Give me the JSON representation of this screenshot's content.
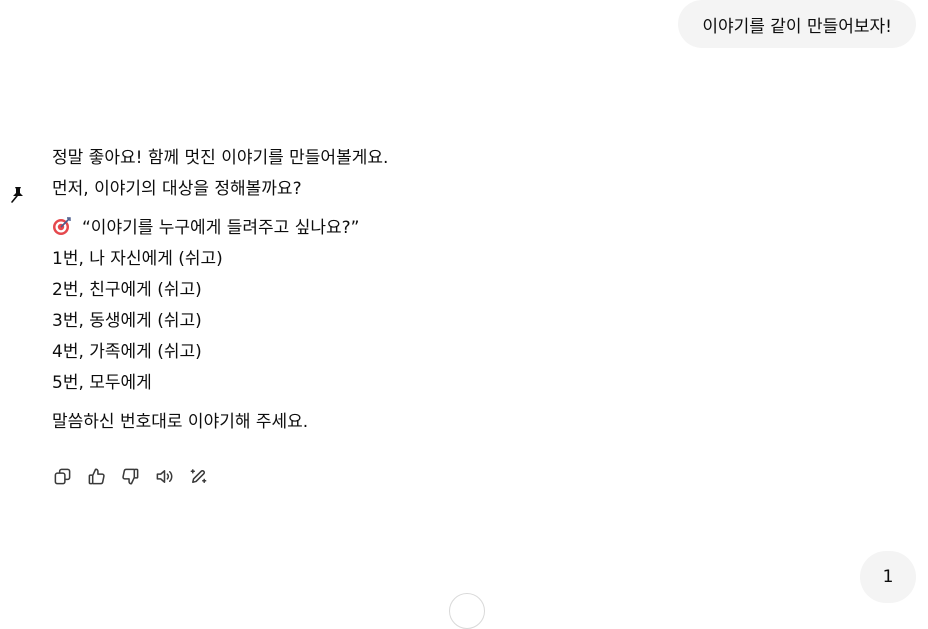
{
  "user_message": "이야기를 같이 만들어보자!",
  "assistant": {
    "intro": [
      "정말 좋아요! 함께 멋진 이야기를 만들어볼게요.",
      "먼저, 이야기의 대상을 정해볼까요?"
    ],
    "question": "“이야기를 누구에게 들려주고 싶나요?”",
    "options": [
      "1번, 나 자신에게 (쉬고)",
      "2번, 친구에게 (쉬고)",
      "3번, 동생에게 (쉬고)",
      "4번, 가족에게 (쉬고)",
      "5번, 모두에게"
    ],
    "closing": "말씀하신 번호대로 이야기해 주세요."
  },
  "icons": {
    "pin": "pin-icon",
    "target": "target-icon",
    "actions": [
      "copy-icon",
      "thumbs-up-icon",
      "thumbs-down-icon",
      "speaker-icon",
      "edit-icon"
    ]
  },
  "page_badge": "1",
  "colors": {
    "bubble_bg": "#f4f4f4",
    "text": "#0d0d0d",
    "icon": "#5d5d5d",
    "target_red": "#e5484d"
  }
}
